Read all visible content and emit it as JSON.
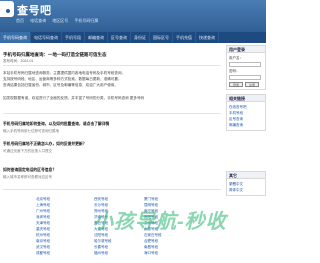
{
  "header": {
    "title": "查号吧",
    "links": [
      "首页",
      "电话查询",
      "地区区号",
      "手机号码归属"
    ]
  },
  "nav": {
    "items": [
      "手机号码查询",
      "电话号码查询",
      "手机号段",
      "邮编查询",
      "区号查询",
      "身份证",
      "国际区号",
      "手机充值",
      "快递查询"
    ]
  },
  "article": {
    "title": "手机号码归属地查询：一地一码打造全链路可信生态",
    "subtitle": "发布时间：2024-01",
    "paragraphs": [
      "本站手机号码归属地查询服务，主要提供国内各地电话号码及手机号段查询，",
      "支持按号码段、地区、运营商等多种方式检索，数据每日更新，准确可靠。",
      "查询结果包括归属省份、城市、区号及邮编等信息，欢迎广大用户使用。",
      "如发现数据有误，欢迎进行了全面的反馈，并丰富了号码的分类，手机号码查询  更多号码"
    ],
    "faq": [
      {
        "q": "手机号码归属地如何查询，以及如何批量查询，请点击了解详情",
        "a": "输入手机号码前七位即可查询归属地"
      },
      {
        "q": "手机号码归属地不正确怎么办，如何反馈并更新？",
        "a": "可通过页面下方的反馈入口提交"
      },
      {
        "q": "如何查询固定电话的区号信息？",
        "a": "输入城市名称即可查看对应区号"
      }
    ]
  },
  "links": {
    "col1": [
      "北京号段",
      "上海号段",
      "广州号段",
      "深圳号段",
      "天津号段",
      "重庆号段",
      "杭州号段",
      "南京号段",
      "武汉号段",
      "成都号段"
    ],
    "col2": [
      "西安号段",
      "长沙号段",
      "郑州号段",
      "济南号段",
      "青岛号段",
      "大连号段",
      "沈阳号段",
      "哈尔滨号段",
      "长春号段",
      "福州号段"
    ],
    "col3": [
      "厦门号段",
      "昆明号段",
      "南宁号段",
      "贵阳号段",
      "兰州号段",
      "太原号段",
      "石家庄号段",
      "合肥号段",
      "南昌号段",
      "海口号段"
    ]
  },
  "sidebar": {
    "login_title": "用户登录",
    "user_label": "用户名：",
    "pass_label": "密码：",
    "login_btn": "登录",
    "reg_btn": "注册",
    "links_title": "相关链接",
    "links": [
      "在线查号吧",
      "手机号段",
      "区号查询",
      "邮编查询"
    ],
    "misc_title": "其它",
    "misc": [
      "繁體中文",
      "简体中文"
    ]
  },
  "watermark": "小孩导航-秒收"
}
